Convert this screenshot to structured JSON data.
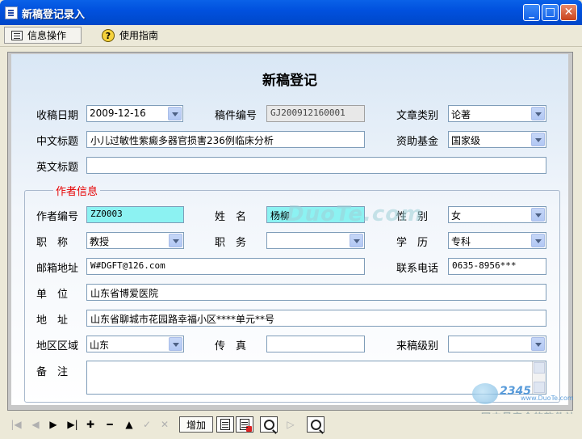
{
  "window": {
    "title": "新稿登记录入"
  },
  "menubar": {
    "items": [
      {
        "label": "信息操作",
        "icon": "list-icon"
      },
      {
        "label": "使用指南",
        "icon": "help-icon"
      }
    ]
  },
  "form": {
    "title": "新稿登记",
    "received_date": {
      "label": "收稿日期",
      "value": "2009-12-16"
    },
    "manuscript_no": {
      "label": "稿件编号",
      "value": "GJ200912160001"
    },
    "article_type": {
      "label": "文章类别",
      "value": "论著"
    },
    "chinese_title": {
      "label": "中文标题",
      "value": "小儿过敏性紫癜多器官损害236例临床分析"
    },
    "funding": {
      "label": "资助基金",
      "value": "国家级"
    },
    "english_title": {
      "label": "英文标题",
      "value": ""
    }
  },
  "author": {
    "section_title": "作者信息",
    "author_no": {
      "label": "作者编号",
      "value": "ZZ0003"
    },
    "name": {
      "label": "姓　名",
      "value": "杨柳"
    },
    "gender": {
      "label": "性　别",
      "value": "女"
    },
    "title": {
      "label": "职　称",
      "value": "教授"
    },
    "position": {
      "label": "职　务",
      "value": ""
    },
    "education": {
      "label": "学　历",
      "value": "专科"
    },
    "email": {
      "label": "邮箱地址",
      "value": "W#DGFT@126.com"
    },
    "phone": {
      "label": "联系电话",
      "value": "0635-8956***"
    },
    "unit": {
      "label": "单　位",
      "value": "山东省博爱医院"
    },
    "address": {
      "label": "地　址",
      "value": "山东省聊城市花园路幸福小区****单元**号"
    },
    "region": {
      "label": "地区区域",
      "value": "山东"
    },
    "fax": {
      "label": "传　真",
      "value": ""
    },
    "submission_level": {
      "label": "来稿级别",
      "value": ""
    },
    "remarks": {
      "label": "备　注",
      "value": ""
    }
  },
  "toolbar": {
    "nav_glyphs": [
      "|◀",
      "◀",
      "▶",
      "▶|",
      "✚",
      "━",
      "▲",
      "✓",
      "✕"
    ],
    "add_label": "增加"
  },
  "watermarks": {
    "site_mark": "DuoTe.com",
    "logo_number": "2345",
    "logo_sub": "www.DuoTe.com",
    "slogan": "国内最安全的软件站"
  },
  "colors": {
    "titlebar": "#0151de",
    "highlight_field": "#8cf2f2",
    "section_title": "#e60000"
  }
}
